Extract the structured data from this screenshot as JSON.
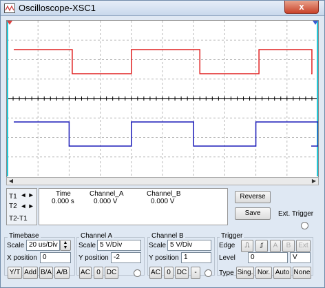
{
  "window": {
    "title": "Oscilloscope-XSC1",
    "close_label": "x"
  },
  "colors": {
    "channel_a": "#e02020",
    "channel_b": "#1a1ab8",
    "cursor_t1": "#e04040",
    "cursor_t2": "#3a5ad0",
    "cursor_line": "#20c8d8",
    "grid": "#b8b8b8"
  },
  "cursors": {
    "t1": "T1",
    "t2": "T2",
    "t2_t1": "T2-T1"
  },
  "readout": {
    "headers": {
      "time": "Time",
      "channel_a": "Channel_A",
      "channel_b": "Channel_B"
    },
    "t1_row": {
      "time": "0.000 s",
      "channel_a": "0.000 V",
      "channel_b": "0.000 V"
    }
  },
  "buttons": {
    "reverse": "Reverse",
    "save": "Save",
    "ext_trigger": "Ext. Trigger"
  },
  "timebase": {
    "title": "Timebase",
    "scale_label": "Scale",
    "scale": "20 us/Div",
    "xpos_label": "X position",
    "xpos": "0",
    "modes": [
      "Y/T",
      "Add",
      "B/A",
      "A/B"
    ]
  },
  "channel_a": {
    "title": "Channel A",
    "scale_label": "Scale",
    "scale": "5  V/Div",
    "ypos_label": "Y position",
    "ypos": "-2",
    "coupling": [
      "AC",
      "0",
      "DC"
    ]
  },
  "channel_b": {
    "title": "Channel B",
    "scale_label": "Scale",
    "scale": "5  V/Div",
    "ypos_label": "Y position",
    "ypos": "1",
    "coupling": [
      "AC",
      "0",
      "DC",
      "-"
    ]
  },
  "trigger": {
    "title": "Trigger",
    "edge_label": "Edge",
    "sources": [
      "A",
      "B",
      "Ext"
    ],
    "level_label": "Level",
    "level": "0",
    "level_unit": "V",
    "type_label": "Type",
    "types": [
      "Sing.",
      "Nor.",
      "Auto",
      "None"
    ]
  },
  "waveforms": {
    "channel_a_edges_div": [
      1.05,
      2.0,
      3.1,
      4.05,
      4.9
    ],
    "channel_b_edges_div": [
      1.0,
      2.0,
      3.0,
      4.0,
      5.0
    ],
    "channel_a_high_first": true,
    "channel_b_high_first": true
  }
}
